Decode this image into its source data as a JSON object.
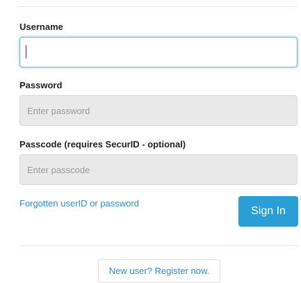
{
  "login_form": {
    "username": {
      "label": "Username",
      "value": "",
      "placeholder": ""
    },
    "password": {
      "label": "Password",
      "placeholder": "Enter password"
    },
    "passcode": {
      "label": "Passcode (requires SecurID - optional)",
      "placeholder": "Enter passcode"
    },
    "forgot_link": "Forgotten userID or password",
    "sign_in_label": "Sign In",
    "register_label": "New user? Register now."
  },
  "colors": {
    "accent": "#2a9fd6",
    "link": "#2a8fc9",
    "focus_border": "#66afe9",
    "disabled_field": "#e9e9e9"
  }
}
